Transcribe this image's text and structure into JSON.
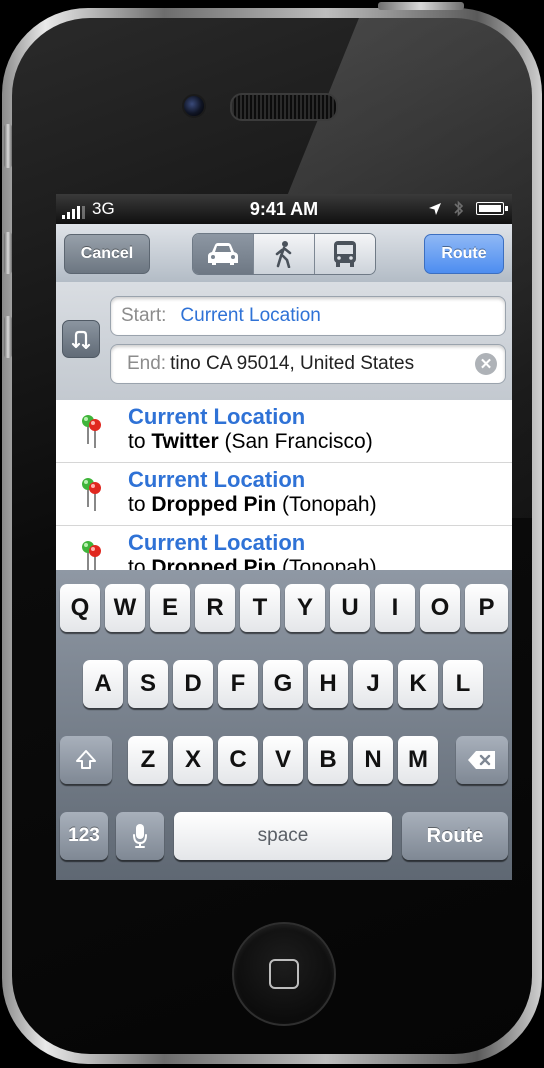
{
  "status_bar": {
    "carrier": "3G",
    "time": "9:41 AM"
  },
  "nav": {
    "cancel_label": "Cancel",
    "route_label": "Route",
    "transport_modes": [
      {
        "icon": "car-icon",
        "selected": true
      },
      {
        "icon": "walking-icon",
        "selected": false
      },
      {
        "icon": "bus-icon",
        "selected": false
      }
    ]
  },
  "route_fields": {
    "start_label": "Start:",
    "start_value": "Current Location",
    "end_label": "End:",
    "end_value": "tino CA 95014, United States"
  },
  "recents": [
    {
      "title": "Current Location",
      "prefix": "to",
      "place": "Twitter",
      "detail": "(San Francisco)"
    },
    {
      "title": "Current Location",
      "prefix": "to",
      "place": "Dropped Pin",
      "detail": "(Tonopah)"
    },
    {
      "title": "Current Location",
      "prefix": "to",
      "place": "Dropped Pin",
      "detail": "(Tonopah)"
    }
  ],
  "keyboard": {
    "row1": [
      "Q",
      "W",
      "E",
      "R",
      "T",
      "Y",
      "U",
      "I",
      "O",
      "P"
    ],
    "row2": [
      "A",
      "S",
      "D",
      "F",
      "G",
      "H",
      "J",
      "K",
      "L"
    ],
    "row3": [
      "Z",
      "X",
      "C",
      "V",
      "B",
      "N",
      "M"
    ],
    "numbers_label": "123",
    "space_label": "space",
    "return_label": "Route"
  },
  "colors": {
    "link_blue": "#2f72d6",
    "route_button": "#4d8df0",
    "pin_green": "#3fb43a",
    "pin_red": "#e0281f"
  }
}
